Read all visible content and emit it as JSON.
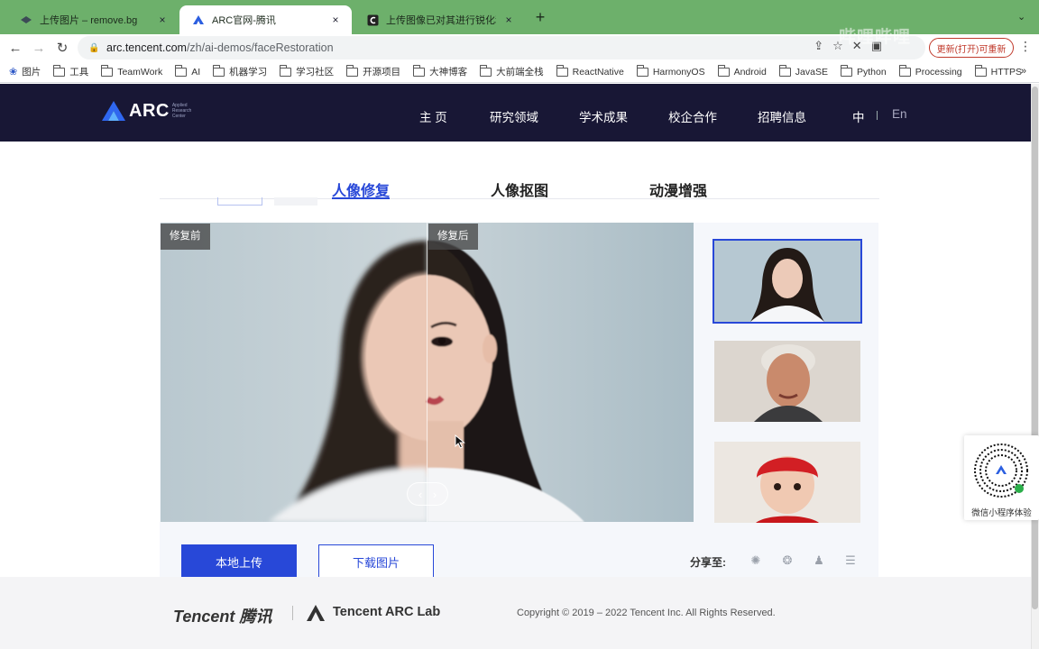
{
  "browser": {
    "tabs": [
      {
        "title": "上传图片 – remove.bg",
        "close": "×"
      },
      {
        "title": "ARC官网-腾讯",
        "close": "×"
      },
      {
        "title": "上传图像已对其进行锐化和放大",
        "close": "×"
      }
    ],
    "new_tab": "+",
    "tab_menu": "⌄",
    "url_host": "arc.tencent.com",
    "url_path": "/zh/ai-demos/faceRestoration",
    "profile_label": "更新(打开)可重新",
    "bookmarks": [
      {
        "label": "图片",
        "icon": "paw-icon"
      },
      {
        "label": "工具",
        "icon": "folder-icon"
      },
      {
        "label": "TeamWork",
        "icon": "folder-icon"
      },
      {
        "label": "AI",
        "icon": "folder-icon"
      },
      {
        "label": "机器学习",
        "icon": "folder-icon"
      },
      {
        "label": "学习社区",
        "icon": "folder-icon"
      },
      {
        "label": "开源项目",
        "icon": "folder-icon"
      },
      {
        "label": "大神博客",
        "icon": "folder-icon"
      },
      {
        "label": "大前端全栈",
        "icon": "folder-icon"
      },
      {
        "label": "ReactNative",
        "icon": "folder-icon"
      },
      {
        "label": "HarmonyOS",
        "icon": "folder-icon"
      },
      {
        "label": "Android",
        "icon": "folder-icon"
      },
      {
        "label": "JavaSE",
        "icon": "folder-icon"
      },
      {
        "label": "Python",
        "icon": "folder-icon"
      },
      {
        "label": "Processing",
        "icon": "folder-icon"
      },
      {
        "label": "HTTPS",
        "icon": "folder-icon"
      }
    ],
    "bookmarks_more": "»"
  },
  "header": {
    "logo_text": "ARC",
    "logo_sub": "Applied Research Center",
    "nav": [
      "主 页",
      "研究领域",
      "学术成果",
      "校企合作",
      "招聘信息"
    ],
    "lang_zh": "中",
    "lang_en": "En"
  },
  "demo": {
    "tabs": [
      "人像修复",
      "人像抠图",
      "动漫增强"
    ],
    "active_tab": 0,
    "before_label": "修复前",
    "after_label": "修复后",
    "upload_label": "本地上传",
    "download_label": "下载图片",
    "share_label": "分享至:",
    "share_icons": [
      "wechat-moments-icon",
      "weibo-icon",
      "qq-icon",
      "qzone-icon"
    ]
  },
  "footer": {
    "tencent": "Tencent 腾讯",
    "arc_lab": "Tencent ARC Lab",
    "copyright": "Copyright © 2019 – 2022 Tencent Inc. All Rights Reserved."
  },
  "qr": {
    "label": "微信小程序体验"
  },
  "watermark": "哔哩哔哩",
  "colors": {
    "accent": "#2848d8",
    "header_bg": "#181735",
    "tabbar": "#6db06b"
  }
}
